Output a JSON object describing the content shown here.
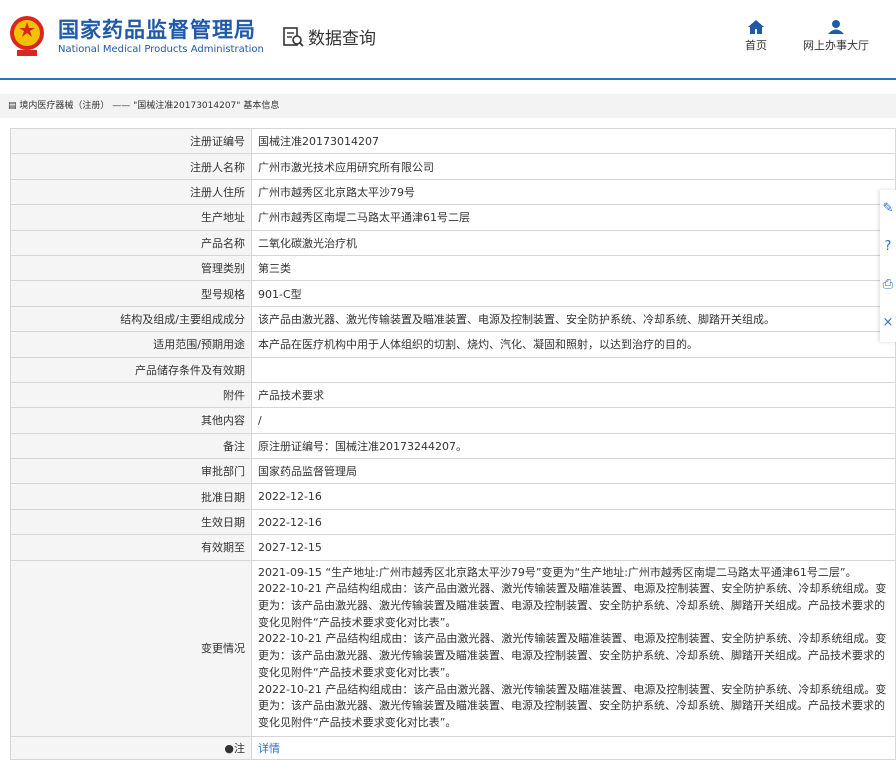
{
  "header": {
    "org_cn": "国家药品监督管理局",
    "org_en": "National Medical Products Administration",
    "data_query": "数据查询",
    "nav_home": "首页",
    "nav_service": "网上办事大厅"
  },
  "breadcrumb": {
    "category": "境内医疗器械（注册）",
    "separator": "——",
    "record": "\"国械注准20173014207\"",
    "page": "基本信息"
  },
  "rows": [
    {
      "label": "注册证编号",
      "value": "国械注准20173014207"
    },
    {
      "label": "注册人名称",
      "value": "广州市激光技术应用研究所有限公司"
    },
    {
      "label": "注册人住所",
      "value": "广州市越秀区北京路太平沙79号"
    },
    {
      "label": "生产地址",
      "value": "广州市越秀区南堤二马路太平通津61号二层"
    },
    {
      "label": "产品名称",
      "value": "二氧化碳激光治疗机"
    },
    {
      "label": "管理类别",
      "value": "第三类"
    },
    {
      "label": "型号规格",
      "value": "901-C型"
    },
    {
      "label": "结构及组成/主要组成成分",
      "value": "该产品由激光器、激光传输装置及瞄准装置、电源及控制装置、安全防护系统、冷却系统、脚踏开关组成。"
    },
    {
      "label": "适用范围/预期用途",
      "value": "本产品在医疗机构中用于人体组织的切割、烧灼、汽化、凝固和照射，以达到治疗的目的。"
    },
    {
      "label": "产品储存条件及有效期",
      "value": ""
    },
    {
      "label": "附件",
      "value": "产品技术要求"
    },
    {
      "label": "其他内容",
      "value": "/"
    },
    {
      "label": "备注",
      "value": "原注册证编号：国械注准20173244207。"
    },
    {
      "label": "审批部门",
      "value": "国家药品监督管理局"
    },
    {
      "label": "批准日期",
      "value": "2022-12-16"
    },
    {
      "label": "生效日期",
      "value": "2022-12-16"
    },
    {
      "label": "有效期至",
      "value": "2027-12-15"
    }
  ],
  "changes": {
    "label": "变更情况",
    "lines": [
      "2021-09-15 “生产地址:广州市越秀区北京路太平沙79号”变更为“生产地址:广州市越秀区南堤二马路太平通津61号二层”。",
      "2022-10-21 产品结构组成由：该产品由激光器、激光传输装置及瞄准装置、电源及控制装置、安全防护系统、冷却系统组成。变更为：该产品由激光器、激光传输装置及瞄准装置、电源及控制装置、安全防护系统、冷却系统、脚踏开关组成。产品技术要求的变化见附件“产品技术要求变化对比表”。",
      "2022-10-21 产品结构组成由：该产品由激光器、激光传输装置及瞄准装置、电源及控制装置、安全防护系统、冷却系统组成。变更为：该产品由激光器、激光传输装置及瞄准装置、电源及控制装置、安全防护系统、冷却系统、脚踏开关组成。产品技术要求的变化见附件“产品技术要求变化对比表”。",
      "2022-10-21 产品结构组成由：该产品由激光器、激光传输装置及瞄准装置、电源及控制装置、安全防护系统、冷却系统组成。变更为：该产品由激光器、激光传输装置及瞄准装置、电源及控制装置、安全防护系统、冷却系统、脚踏开关组成。产品技术要求的变化见附件“产品技术要求变化对比表”。"
    ]
  },
  "note_row": {
    "label": "注",
    "link": "详情"
  },
  "icons": [
    "national-emblem-icon",
    "data-query-icon",
    "home-icon",
    "user-icon",
    "document-icon",
    "edit-icon",
    "help-icon",
    "print-icon",
    "close-icon",
    "comment-icon"
  ],
  "colors": {
    "brand": "#1f5aa8",
    "accent": "#2e6fc0",
    "label_bg": "#f5f5f5",
    "border": "#d6d6d6"
  }
}
